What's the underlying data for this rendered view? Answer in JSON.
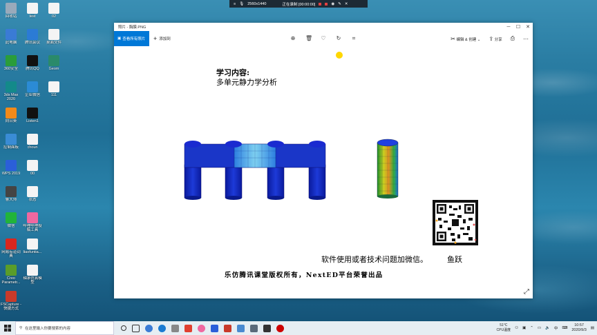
{
  "desktop": {
    "col1": [
      {
        "label": "回收站",
        "color": "#9ab"
      },
      {
        "label": "此电脑",
        "color": "#3a7bd5"
      },
      {
        "label": "360安全",
        "color": "#2a9d3a"
      },
      {
        "label": "3ds Max 2020",
        "color": "#138a8a"
      },
      {
        "label": "向日葵",
        "color": "#f28a1a"
      },
      {
        "label": "控制面板",
        "color": "#3a8cd5"
      },
      {
        "label": "WPS 2019",
        "color": "#2b5fd9"
      },
      {
        "label": "鲁大师",
        "color": "#444"
      },
      {
        "label": "微信",
        "color": "#21b43a"
      },
      {
        "label": "网易有道词典",
        "color": "#d9271e"
      },
      {
        "label": "Creo Parametr...",
        "color": "#5a9d2a"
      },
      {
        "label": "FSCapture - 快捷方式",
        "color": "#c93a2a"
      }
    ],
    "col2": [
      {
        "label": "test",
        "color": "#f4f4f4"
      },
      {
        "label": "腾讯会议",
        "color": "#2b7bd5"
      },
      {
        "label": "腾讯QQ",
        "color": "#111"
      },
      {
        "label": "企业微信",
        "color": "#2b8bd5"
      },
      {
        "label": "Listen1",
        "color": "#111"
      },
      {
        "label": "choun",
        "color": "#f4f4f4"
      },
      {
        "label": "00",
        "color": "#f4f4f4"
      },
      {
        "label": "状态",
        "color": "#f4f4f4"
      },
      {
        "label": "哔哩哔哩投稿工具",
        "color": "#f068a0"
      },
      {
        "label": "liaofuntia...",
        "color": "#f4f4f4"
      },
      {
        "label": "轴承仿真模型",
        "color": "#f4f4f4"
      }
    ],
    "col3": [
      {
        "label": "02",
        "color": "#f4f4f4"
      },
      {
        "label": "桌面文件",
        "color": "#f4f4f4"
      },
      {
        "label": "Geom",
        "color": "#2a8a6a"
      },
      {
        "label": "111",
        "color": "#f4f4f4"
      }
    ]
  },
  "recording_bar": {
    "resolution": "2560x1440",
    "status": "正在录制 [00:00:00]"
  },
  "window": {
    "title": "照片 - 胸膜.PNG",
    "back_label": "查看所有照片",
    "add_label": "添加到",
    "edit_label": "编辑 & 创建",
    "share_label": "分享"
  },
  "slide": {
    "title_line1": "学习内容:",
    "title_line2": "多单元静力学分析",
    "contact": "软件使用或者技术问题加微信。",
    "contact_name": "鱼跃",
    "copyright": "乐仿腾讯课堂版权所有，NextED平台荣誉出品"
  },
  "taskbar": {
    "search_placeholder": "在这里输入你要搜索的内容",
    "weather_temp": "51°C",
    "weather_label": "CPU温度",
    "ime": "中",
    "time": "10:57",
    "date": "2020/9/3"
  }
}
